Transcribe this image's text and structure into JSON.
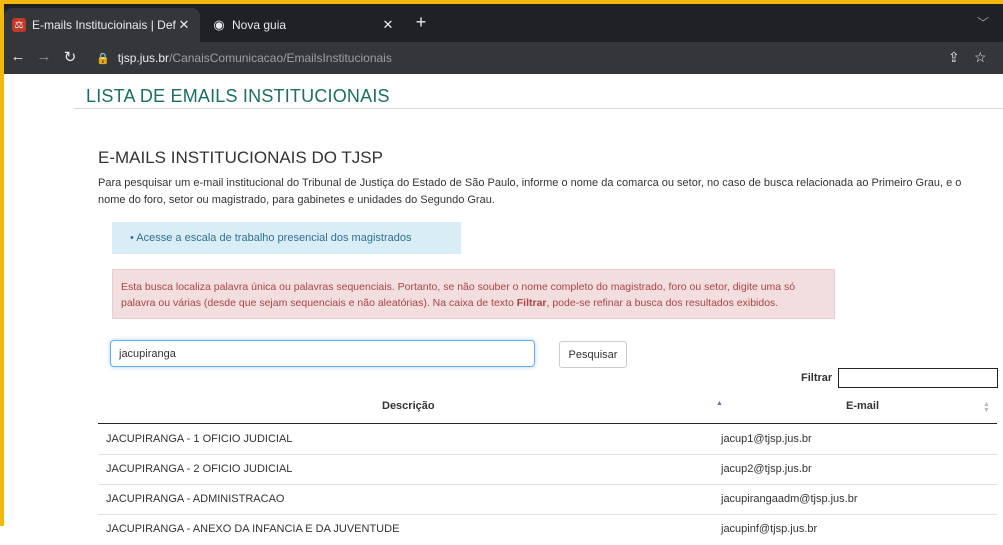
{
  "browser": {
    "tabs": [
      {
        "title": "E-mails Institucioinais | Default",
        "favicon": "tjsp-favicon",
        "active": true
      },
      {
        "title": "Nova guia",
        "favicon": "chrome-icon",
        "active": false
      }
    ],
    "new_tab": "+",
    "address": {
      "host": "tjsp.jus.br",
      "path": "/CanaisComunicacao/EmailsInstitucionais"
    }
  },
  "page": {
    "section_title": "LISTA DE EMAILS INSTITUCIONAIS",
    "heading": "E-MAILS INSTITUCIONAIS DO TJSP",
    "intro": "Para pesquisar um e-mail institucional do Tribunal de Justiça do Estado de São Paulo, informe o nome da comarca ou setor, no caso de busca relacionada ao Primeiro Grau, e o nome do foro, setor ou magistrado, para gabinetes e unidades do Segundo Grau.",
    "info_link": "• Acesse a escala de trabalho presencial dos magistrados",
    "warning": {
      "part1": "Esta busca localiza palavra única ou palavras sequenciais. Portanto, se não souber o nome completo do magistrado, foro ou setor, digite uma só palavra ou várias (desde que sejam sequenciais e não aleatórias). Na caixa de texto ",
      "bold": "Filtrar",
      "part2": ", pode-se refinar a busca dos resultados exibidos."
    },
    "search_value": "jacupiranga",
    "search_button": "Pesquisar",
    "filter_label": "Filtrar",
    "filter_value": "",
    "table": {
      "headers": {
        "description": "Descrição",
        "email": "E-mail"
      },
      "rows": [
        {
          "description": "JACUPIRANGA - 1 OFICIO JUDICIAL",
          "email": "jacup1@tjsp.jus.br"
        },
        {
          "description": "JACUPIRANGA - 2 OFICIO JUDICIAL",
          "email": "jacup2@tjsp.jus.br"
        },
        {
          "description": "JACUPIRANGA - ADMINISTRACAO",
          "email": "jacupirangaadm@tjsp.jus.br"
        },
        {
          "description": "JACUPIRANGA - ANEXO DA INFANCIA E DA JUVENTUDE",
          "email": "jacupinf@tjsp.jus.br"
        }
      ]
    }
  },
  "colors": {
    "accent": "#1a6e63",
    "info_bg": "#d9edf7",
    "warning_bg": "#f2dede",
    "warning_text": "#a94442"
  }
}
